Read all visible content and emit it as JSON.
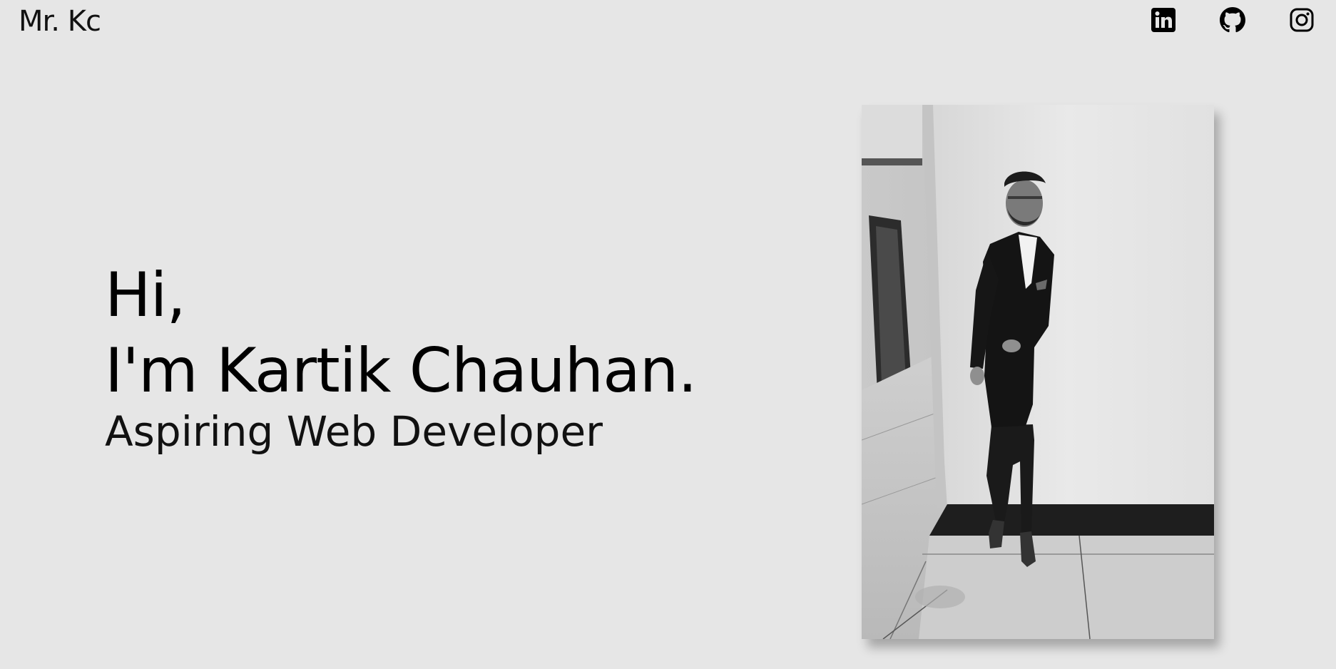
{
  "header": {
    "brand": "Mr. Kc",
    "socials": [
      {
        "icon": "linkedin-icon"
      },
      {
        "icon": "github-icon"
      },
      {
        "icon": "instagram-icon"
      }
    ]
  },
  "hero": {
    "greeting": "Hi,",
    "name_line": "I'm Kartik Chauhan.",
    "role": "Aspiring Web Developer"
  },
  "photo": {
    "subject": "portrait-photo"
  },
  "colors": {
    "background": "#e6e6e6",
    "text": "#000000"
  }
}
